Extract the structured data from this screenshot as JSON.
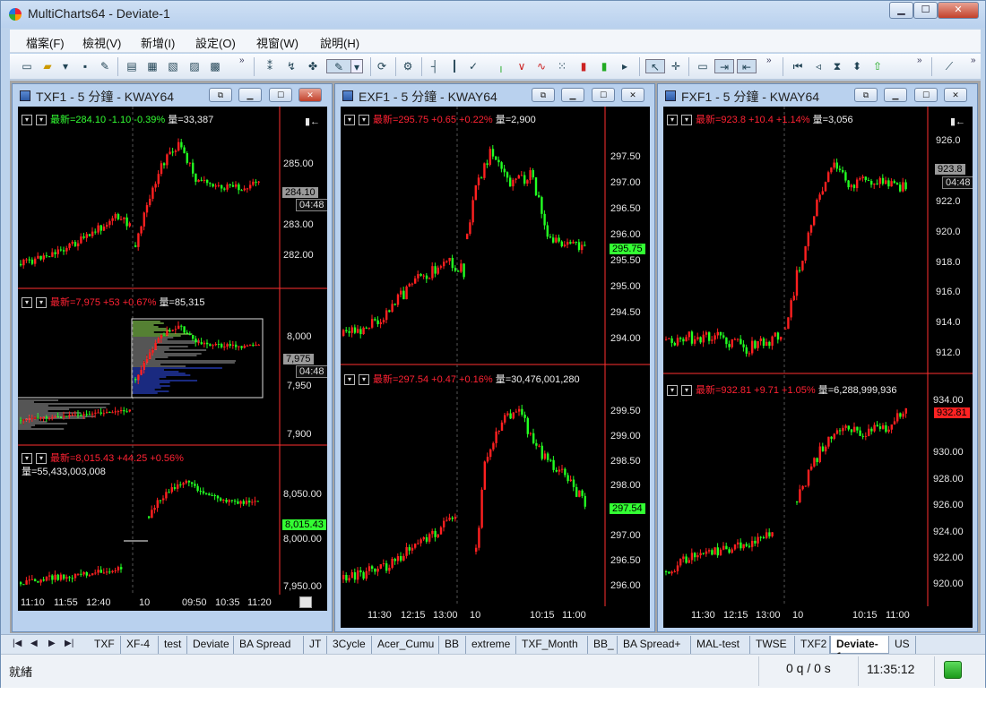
{
  "app": {
    "title": "MultiCharts64 - Deviate-1",
    "min": "▁",
    "max": "☐",
    "close": "✕"
  },
  "menu": [
    "檔案(F)",
    "檢視(V)",
    "新增(I)",
    "設定(O)",
    "視窗(W)",
    "說明(H)"
  ],
  "colors": {
    "up": "#ff2020",
    "down": "#22ff22",
    "bg": "#000000",
    "grid": "#444444"
  },
  "windows": [
    {
      "title": "TXF1 - 5 分鐘 - KWAY64",
      "panes": [
        {
          "parts": [
            {
              "t": "最新=284.10",
              "c": "grn"
            },
            {
              "t": "-1.10",
              "c": "grn"
            },
            {
              "t": "-0.39%",
              "c": "grn"
            },
            {
              "t": "量=33,387",
              "c": "wht"
            }
          ],
          "ticks": [
            "285.00",
            "283.00",
            "282.00"
          ],
          "tag": "284.10",
          "tagtime": "04:48"
        },
        {
          "parts": [
            {
              "t": "最新=7,975",
              "c": "red"
            },
            {
              "t": "+53",
              "c": "red"
            },
            {
              "t": "+0.67%",
              "c": "red"
            },
            {
              "t": "量=85,315",
              "c": "wht"
            }
          ],
          "ticks": [
            "8,000",
            "7,950",
            "7,900"
          ],
          "tag": "7,975",
          "tagtime": "04:48"
        },
        {
          "parts": [
            {
              "t": "最新=8,015.43",
              "c": "red"
            },
            {
              "t": "+44.25",
              "c": "red"
            },
            {
              "t": "+0.56%",
              "c": "red"
            }
          ],
          "line2": "量=55,433,003,008",
          "ticks": [
            "8,050.00",
            "8,000.00",
            "7,950.00"
          ],
          "tag": "8,015.43",
          "tagtime": ""
        }
      ],
      "xticks": [
        "11:10",
        "11:55",
        "12:40",
        "10",
        "09:50",
        "10:35",
        "11:20"
      ]
    },
    {
      "title": "EXF1 - 5 分鐘 - KWAY64",
      "panes": [
        {
          "parts": [
            {
              "t": "最新=295.75",
              "c": "red"
            },
            {
              "t": "+0.65",
              "c": "red"
            },
            {
              "t": "+0.22%",
              "c": "red"
            },
            {
              "t": "量=2,900",
              "c": "wht"
            }
          ],
          "ticks": [
            "297.50",
            "297.00",
            "296.50",
            "296.00",
            "295.50",
            "295.00",
            "294.50",
            "294.00"
          ],
          "tag": "295.75",
          "tagtime": ""
        },
        {
          "parts": [
            {
              "t": "最新=297.54",
              "c": "red"
            },
            {
              "t": "+0.47",
              "c": "red"
            },
            {
              "t": "+0.16%",
              "c": "red"
            },
            {
              "t": "量=30,476,001,280",
              "c": "wht"
            }
          ],
          "ticks": [
            "299.50",
            "299.00",
            "298.50",
            "298.00",
            "297.00",
            "296.50",
            "296.00"
          ],
          "tag": "297.54",
          "tagtime": ""
        }
      ],
      "xticks": [
        "11:30",
        "12:15",
        "13:00",
        "10",
        "10:15",
        "11:00"
      ]
    },
    {
      "title": "FXF1 - 5 分鐘 - KWAY64",
      "panes": [
        {
          "parts": [
            {
              "t": "最新=923.8",
              "c": "red"
            },
            {
              "t": "+10.4",
              "c": "red"
            },
            {
              "t": "+1.14%",
              "c": "red"
            },
            {
              "t": "量=3,056",
              "c": "wht"
            }
          ],
          "ticks": [
            "926.0",
            "922.0",
            "920.0",
            "918.0",
            "916.0",
            "914.0",
            "912.0"
          ],
          "tag": "923.8",
          "tagtime": "04:48"
        },
        {
          "parts": [
            {
              "t": "最新=932.81",
              "c": "red"
            },
            {
              "t": "+9.71",
              "c": "red"
            },
            {
              "t": "+1.05%",
              "c": "red"
            },
            {
              "t": "量=6,288,999,936",
              "c": "wht"
            }
          ],
          "ticks": [
            "934.00",
            "932.00",
            "930.00",
            "928.00",
            "926.00",
            "924.00",
            "922.00",
            "920.00"
          ],
          "tag": "932.81",
          "tagtime": ""
        }
      ],
      "xticks": [
        "11:30",
        "12:15",
        "13:00",
        "10",
        "10:15",
        "11:00"
      ]
    }
  ],
  "tabs": [
    "TXF",
    "XF-4",
    "test",
    "Deviate",
    "BA Spread",
    "JT",
    "3Cycle",
    "Acer_Cumu",
    "BB",
    "extreme",
    "TXF_Month",
    "BB_",
    "BA Spread+",
    "MAL-test",
    "TWSE",
    "TXF2",
    "Deviate-1",
    "US"
  ],
  "active_tab": "Deviate-1",
  "status": {
    "text": "就緒",
    "orders": "0 q / 0 s",
    "clock": "11:35:12"
  }
}
